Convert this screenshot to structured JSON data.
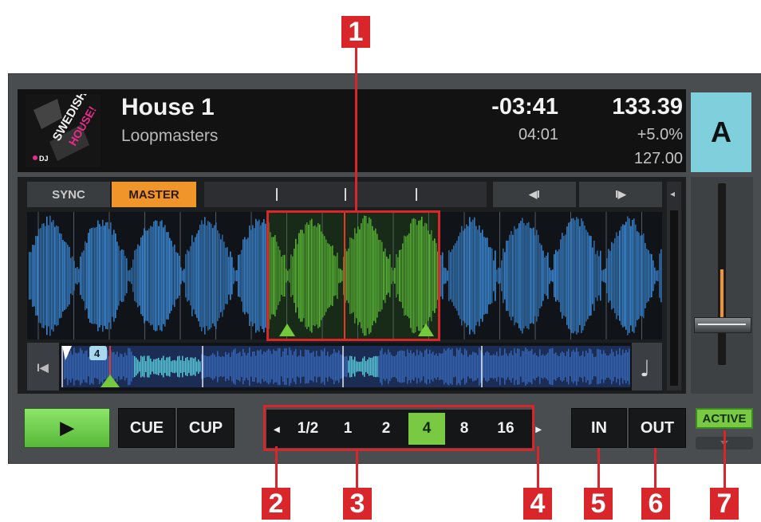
{
  "callouts": [
    "1",
    "2",
    "3",
    "4",
    "5",
    "6",
    "7"
  ],
  "track": {
    "title": "House 1",
    "artist": "Loopmasters",
    "remaining": "-03:41",
    "length": "04:01",
    "tempo": "133.39",
    "pitch_offset": "+5.0%",
    "original_tempo": "127.00",
    "deck": "A",
    "cover_text": {
      "line1": "SWEDISH",
      "line2": "HOUSE!",
      "logo": "DJ"
    }
  },
  "buttons": {
    "sync": "SYNC",
    "master": "MASTER",
    "nudge_back": "◀I",
    "nudge_fwd": "I▶",
    "play": "▶",
    "cue": "CUE",
    "cup": "CUP",
    "in": "IN",
    "out": "OUT",
    "active": "ACTIVE"
  },
  "loop_sizes": [
    "1/2",
    "1",
    "2",
    "4",
    "8",
    "16"
  ],
  "loop_selected": "4",
  "cue_marker": "4",
  "colors": {
    "accent": "#d8262b",
    "master": "#f0952a",
    "deck": "#7fcfdc",
    "loop_selected": "#7ac943",
    "play": "#6fd64a",
    "waveform": "#3c8ad8",
    "loop_waveform": "#69d03f"
  },
  "icons": {
    "prev_arrow": "◂",
    "next_arrow": "▸",
    "skip_start": "I◀",
    "note": "♩",
    "scroll": "◂"
  }
}
